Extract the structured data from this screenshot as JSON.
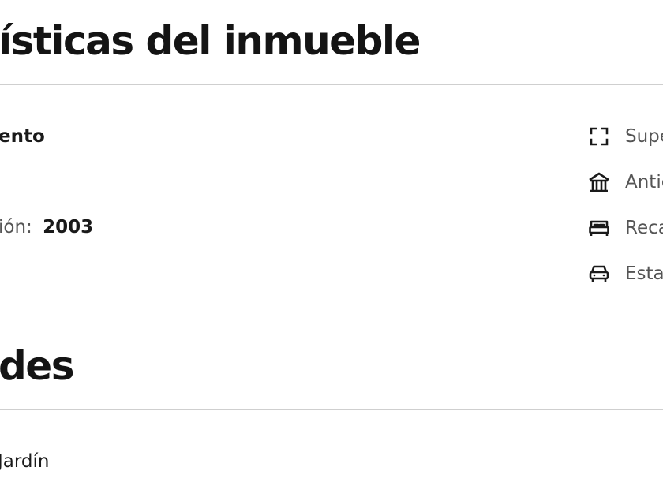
{
  "sections": {
    "characteristics": {
      "title": "ísticas del inmueble",
      "type_value": "ento",
      "year_label": "ión:",
      "year_value": "2003"
    },
    "amenities": {
      "title": "des",
      "items": [
        "Jardín"
      ]
    }
  },
  "features": [
    {
      "icon": "expand-frame-icon",
      "label": "Supe"
    },
    {
      "icon": "house-pillars-icon",
      "label": "Antic"
    },
    {
      "icon": "bed-icon",
      "label": "Reca"
    },
    {
      "icon": "car-icon",
      "label": "Esta"
    }
  ]
}
